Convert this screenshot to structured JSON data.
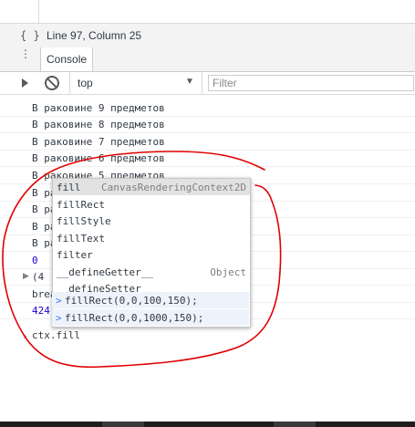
{
  "status_bar": {
    "braces_icon": "{ }",
    "position": "Line 97, Column 25"
  },
  "drawer": {
    "menu_icon": "⋮",
    "tab": "Console"
  },
  "toolbar": {
    "context": "top",
    "context_arrow": "▼",
    "filter_placeholder": "Filter"
  },
  "console": {
    "messages": [
      "В раковине 9 предметов",
      "В раковине 8 предметов",
      "В раковине 7 предметов",
      "В раковине 6 предметов",
      "В раковине 5 предметов",
      "В ра",
      "В ра",
      "В ра",
      "В ра",
      "0",
      "(4",
      "brea",
      "424"
    ],
    "autocomplete": [
      {
        "label": "fill",
        "hint": "CanvasRenderingContext2D"
      },
      {
        "label": "fillRect",
        "hint": ""
      },
      {
        "label": "fillStyle",
        "hint": ""
      },
      {
        "label": "fillText",
        "hint": ""
      },
      {
        "label": "filter",
        "hint": ""
      },
      {
        "label": "__defineGetter__",
        "hint": "Object"
      },
      {
        "label": "__defineSetter__",
        "hint": ""
      }
    ],
    "history": [
      {
        "icon": ">",
        "text": "fillRect(0,0,100,150);"
      },
      {
        "icon": ">",
        "text": "fillRect(0,0,1000,150);"
      }
    ],
    "prompt_icon": "›",
    "input": "ctx.fill"
  },
  "colors": {
    "annotation": "#e00000",
    "selected_item": "#e2e2e2",
    "history_bg": "#eef3fb",
    "number": "#1c00cf",
    "prompt": "#367cf1"
  }
}
